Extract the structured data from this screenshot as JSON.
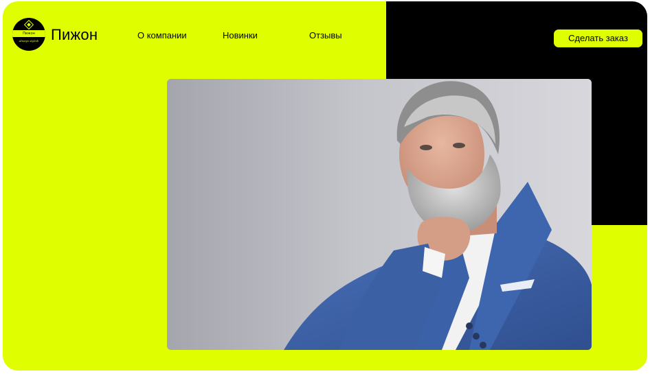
{
  "header": {
    "logo": {
      "icon": "pizhon-logo-icon",
      "badge_text": "Пижон",
      "script_text": "Always stylish"
    },
    "brand_name": "Пижон",
    "nav": [
      {
        "label": "О компании"
      },
      {
        "label": "Новинки"
      },
      {
        "label": "Отзывы"
      }
    ],
    "order_button": "Сделать заказ"
  },
  "hero": {
    "image": "portrait-of-gray-haired-bearded-man-in-blue-suit"
  },
  "colors": {
    "accent": "#dfff00",
    "dark": "#000000",
    "suit": "#3e63a8"
  }
}
